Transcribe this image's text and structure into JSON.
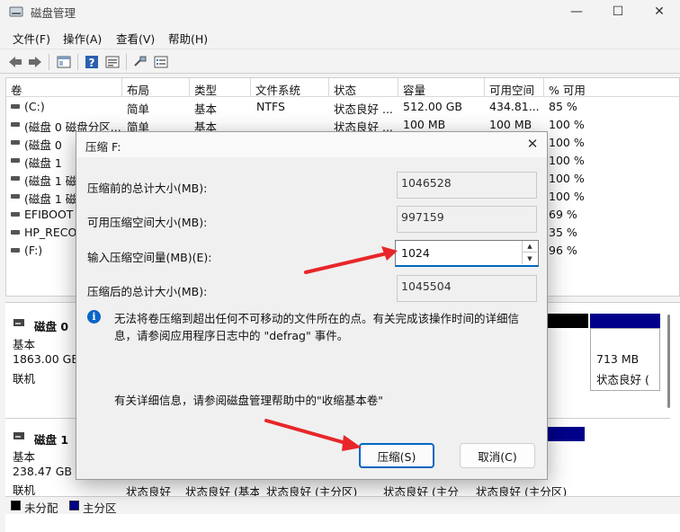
{
  "window": {
    "title": "磁盘管理",
    "controls": {
      "minimize": "—",
      "maximize": "☐",
      "close": "✕"
    }
  },
  "menu": [
    "文件(F)",
    "操作(A)",
    "查看(V)",
    "帮助(H)"
  ],
  "columns": [
    "卷",
    "布局",
    "类型",
    "文件系统",
    "状态",
    "容量",
    "可用空间",
    "% 可用"
  ],
  "volumes": [
    {
      "name": "(C:)",
      "layout": "简单",
      "type": "基本",
      "fs": "NTFS",
      "status": "状态良好 ...",
      "capacity": "512.00 GB",
      "free": "434.81...",
      "pct": "85 %"
    },
    {
      "name": "(磁盘 0 磁盘分区...",
      "layout": "简单",
      "type": "基本",
      "fs": "",
      "status": "状态良好 ...",
      "capacity": "100 MB",
      "free": "100 MB",
      "pct": "100 %"
    },
    {
      "name": "(磁盘 0",
      "layout": "",
      "type": "",
      "fs": "",
      "status": "",
      "capacity": "",
      "free": "",
      "pct": "100 %"
    },
    {
      "name": "(磁盘 1",
      "layout": "",
      "type": "",
      "fs": "",
      "status": "",
      "capacity": "",
      "free": "",
      "pct": "100 %"
    },
    {
      "name": "(磁盘 1 磁",
      "layout": "",
      "type": "",
      "fs": "",
      "status": "",
      "capacity": "",
      "free": "",
      "pct": "100 %"
    },
    {
      "name": "(磁盘 1 磁",
      "layout": "",
      "type": "",
      "fs": "",
      "status": "",
      "capacity": "",
      "free": "",
      "pct": "100 %"
    },
    {
      "name": "EFIBOOT",
      "layout": "",
      "type": "",
      "fs": "",
      "status": "",
      "capacity": "",
      "free": "",
      "pct": "69 %"
    },
    {
      "name": "HP_RECO",
      "layout": "",
      "type": "",
      "fs": "",
      "status": "",
      "capacity": "",
      "free": "",
      "pct": "35 %"
    },
    {
      "name": "(F:)",
      "layout": "",
      "type": "",
      "fs": "",
      "status": "",
      "capacity": "",
      "free": "",
      "pct": "96 %"
    }
  ],
  "disks": [
    {
      "name": "磁盘 0",
      "kind": "基本",
      "size": "1863.00 GB",
      "state": "联机",
      "right_partition": {
        "size": "713 MB",
        "status": "状态良好 ("
      }
    },
    {
      "name": "磁盘 1",
      "kind": "基本",
      "size": "238.47 GB",
      "state": "联机",
      "partition_statuses": [
        "状态良好",
        "状态良好 (基本",
        "状态良好 (主分区)",
        "状态良好 (主分",
        "状态良好 (主分区)"
      ]
    }
  ],
  "legend": {
    "unallocated": "未分配",
    "primary": "主分区"
  },
  "colors": {
    "unallocated": "#000000",
    "primary": "#00008b",
    "accent": "#0067c0",
    "annotation": "#e8262a"
  },
  "dialog": {
    "title": "压缩 F:",
    "close": "✕",
    "total_before_label": "压缩前的总计大小(MB):",
    "total_before_value": "1046528",
    "available_label": "可用压缩空间大小(MB):",
    "available_value": "997159",
    "amount_label": "输入压缩空间量(MB)(E):",
    "amount_value": "1024",
    "total_after_label": "压缩后的总计大小(MB):",
    "total_after_value": "1045504",
    "info_icon": "i",
    "info_text": "无法将卷压缩到超出任何不可移动的文件所在的点。有关完成该操作时间的详细信息，请参阅应用程序日志中的 \"defrag\" 事件。",
    "help_text": "有关详细信息，请参阅磁盘管理帮助中的\"收缩基本卷\"",
    "shrink_button": "压缩(S)",
    "cancel_button": "取消(C)"
  }
}
